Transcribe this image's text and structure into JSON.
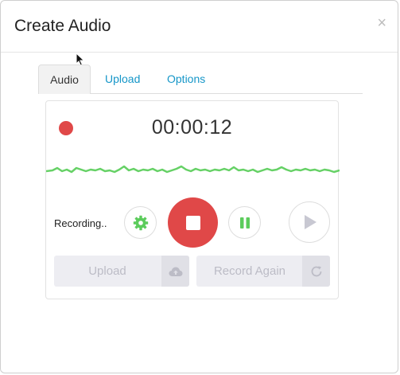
{
  "dialog": {
    "title": "Create Audio",
    "close_glyph": "×"
  },
  "tabs": [
    {
      "label": "Audio",
      "active": true
    },
    {
      "label": "Upload",
      "active": false
    },
    {
      "label": "Options",
      "active": false
    }
  ],
  "recorder": {
    "timer": "00:00:12",
    "status": "Recording..",
    "colors": {
      "record": "#e04848",
      "waveform": "#66d166",
      "control_icon": "#5ccc5c"
    },
    "actions": {
      "upload_label": "Upload",
      "record_again_label": "Record Again"
    },
    "icons": {
      "settings": "gear-icon",
      "stop": "stop-icon",
      "pause": "pause-icon",
      "play": "play-icon",
      "upload": "cloud-upload-icon",
      "record_again": "refresh-icon"
    }
  }
}
